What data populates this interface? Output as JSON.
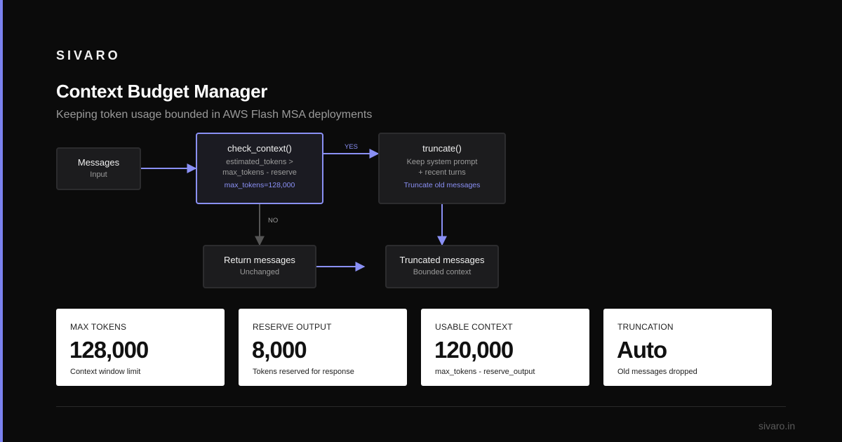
{
  "brand": "SIVARO",
  "title": "Context Budget Manager",
  "subtitle": "Keeping token usage bounded in AWS Flash MSA deployments",
  "colors": {
    "accent": "#8a90f5",
    "background": "#0b0b0b",
    "node_bg": "#1c1c1e",
    "card_bg": "#ffffff"
  },
  "flow": {
    "messages": {
      "title": "Messages",
      "sub": "Input"
    },
    "check": {
      "title": "check_context()",
      "line1": "estimated_tokens >",
      "line2": "max_tokens - reserve",
      "accent": "max_tokens=128,000"
    },
    "truncate": {
      "title": "truncate()",
      "line1": "Keep system prompt",
      "line2": "+ recent turns",
      "accent": "Truncate old messages"
    },
    "return": {
      "title": "Return messages",
      "sub": "Unchanged"
    },
    "truncated": {
      "title": "Truncated messages",
      "sub": "Bounded context"
    },
    "edge_yes": "YES",
    "edge_no": "NO"
  },
  "cards": [
    {
      "label": "MAX TOKENS",
      "value": "128,000",
      "desc": "Context window limit"
    },
    {
      "label": "RESERVE OUTPUT",
      "value": "8,000",
      "desc": "Tokens reserved for response"
    },
    {
      "label": "USABLE CONTEXT",
      "value": "120,000",
      "desc": "max_tokens - reserve_output"
    },
    {
      "label": "TRUNCATION",
      "value": "Auto",
      "desc": "Old messages dropped"
    }
  ],
  "footer": "sivaro.in"
}
